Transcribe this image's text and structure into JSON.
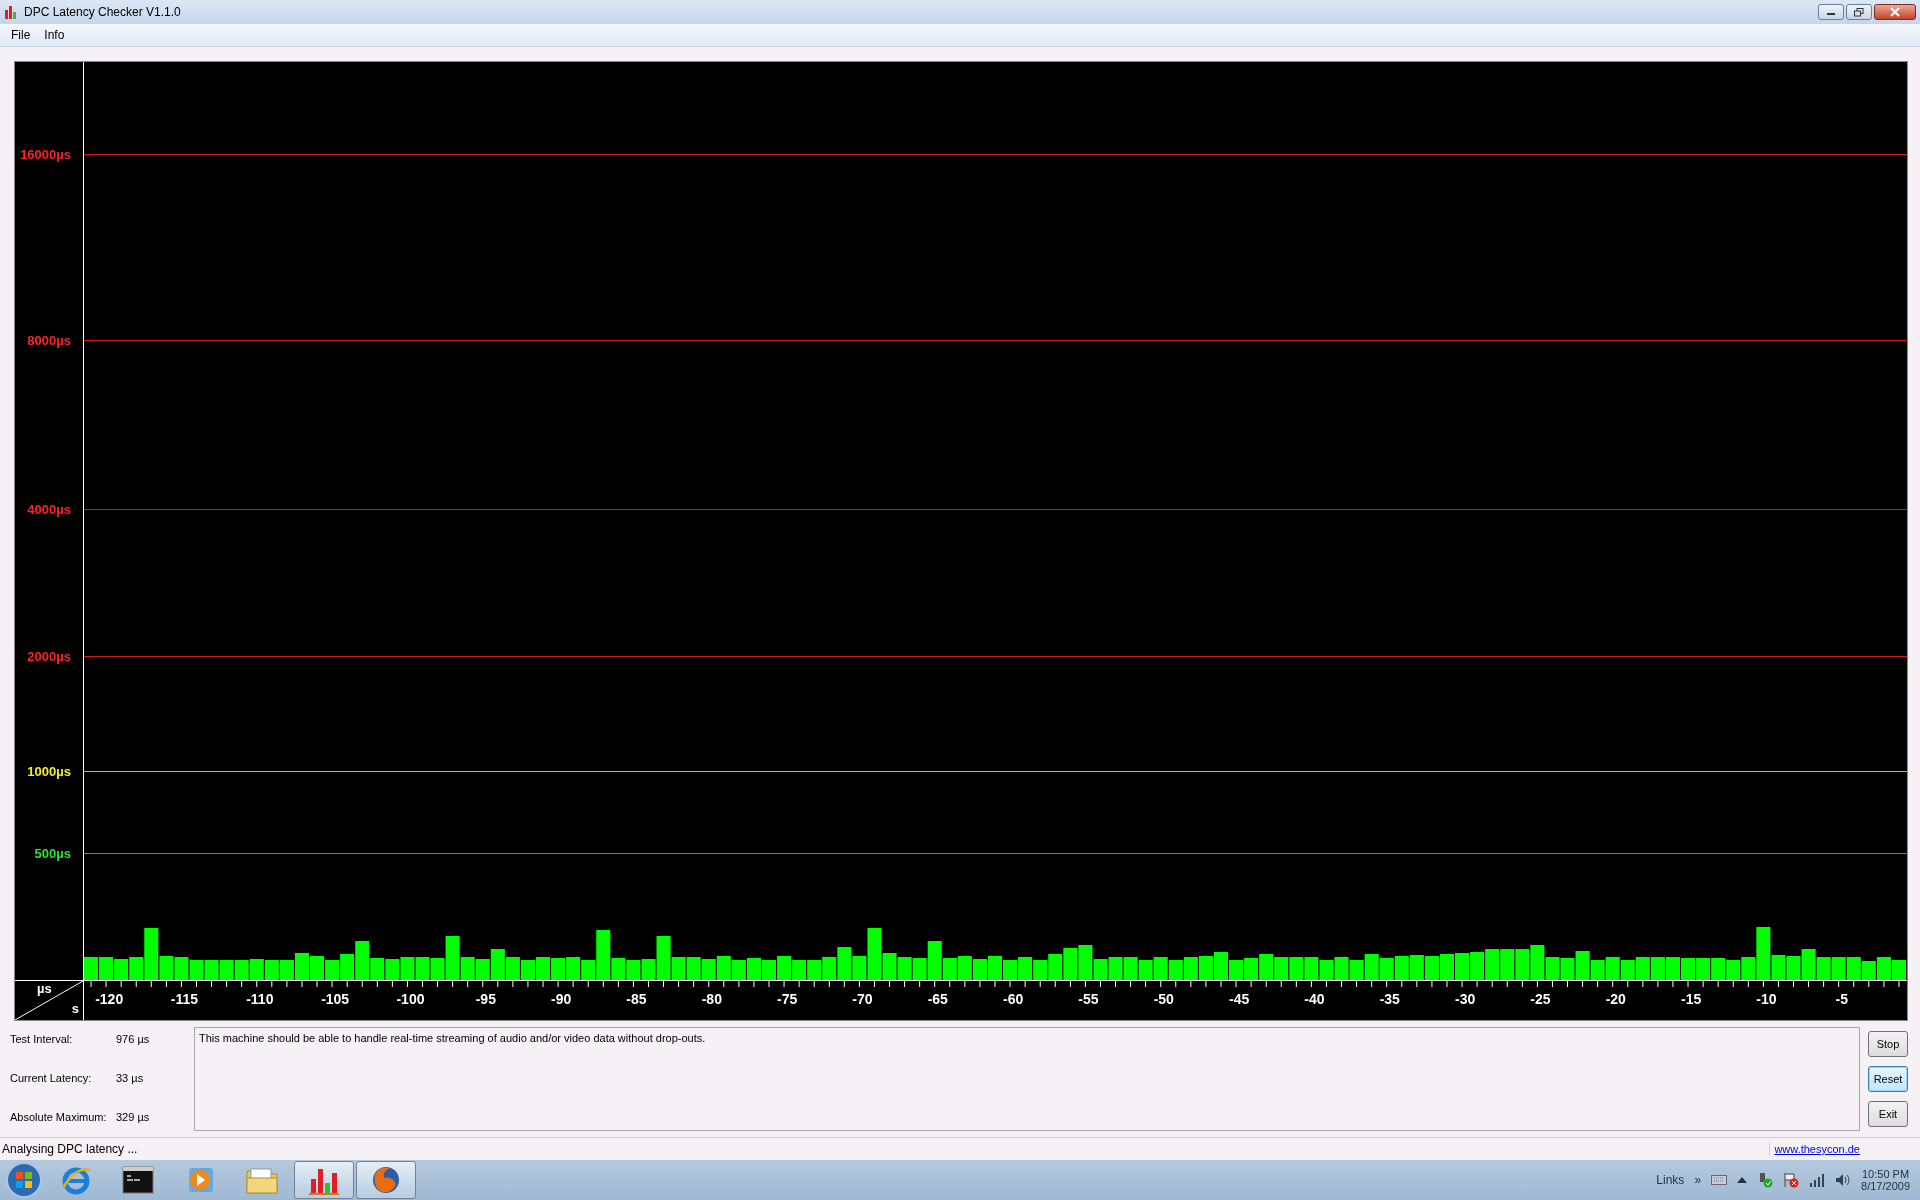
{
  "window": {
    "title": "DPC Latency Checker V1.1.0"
  },
  "menu": [
    "File",
    "Info"
  ],
  "chart": {
    "y_labels": [
      {
        "text": "16000µs",
        "color": "#ff2020"
      },
      {
        "text": "8000µs",
        "color": "#ff2020"
      },
      {
        "text": "4000µs",
        "color": "#ff2020"
      },
      {
        "text": "2000µs",
        "color": "#ff2020"
      },
      {
        "text": "1000µs",
        "color": "#f0f020"
      },
      {
        "text": "500µs",
        "color": "#30e030"
      }
    ],
    "x_labels": [
      "-120",
      "-115",
      "-110",
      "-105",
      "-100",
      "-95",
      "-90",
      "-85",
      "-80",
      "-75",
      "-70",
      "-65",
      "-60",
      "-55",
      "-50",
      "-45",
      "-40",
      "-35",
      "-30",
      "-25",
      "-20",
      "-15",
      "-10",
      "-5"
    ],
    "corner": {
      "top": "µs",
      "bottom": "s"
    }
  },
  "readings": [
    {
      "label": "Test Interval:",
      "value": "976 µs"
    },
    {
      "label": "Current Latency:",
      "value": "33 µs"
    },
    {
      "label": "Absolute Maximum:",
      "value": "329 µs"
    }
  ],
  "message": "This machine should be able to handle real-time streaming of audio and/or video data without drop-outs.",
  "buttons": [
    {
      "label": "Stop",
      "focused": false
    },
    {
      "label": "Reset",
      "focused": true
    },
    {
      "label": "Exit",
      "focused": false
    }
  ],
  "status_bar": {
    "text": "Analysing DPC latency ...",
    "link": "www.thesycon.de"
  },
  "taskbar": {
    "apps": [
      {
        "kind": "browser",
        "running": false
      },
      {
        "kind": "console",
        "running": false
      },
      {
        "kind": "media",
        "running": false
      },
      {
        "kind": "folder",
        "running": false
      },
      {
        "kind": "meter",
        "running": true
      },
      {
        "kind": "fox",
        "running": true
      }
    ],
    "links": "Links",
    "chevron": "»",
    "time": "10:50 PM",
    "date": "8/17/2009"
  }
}
